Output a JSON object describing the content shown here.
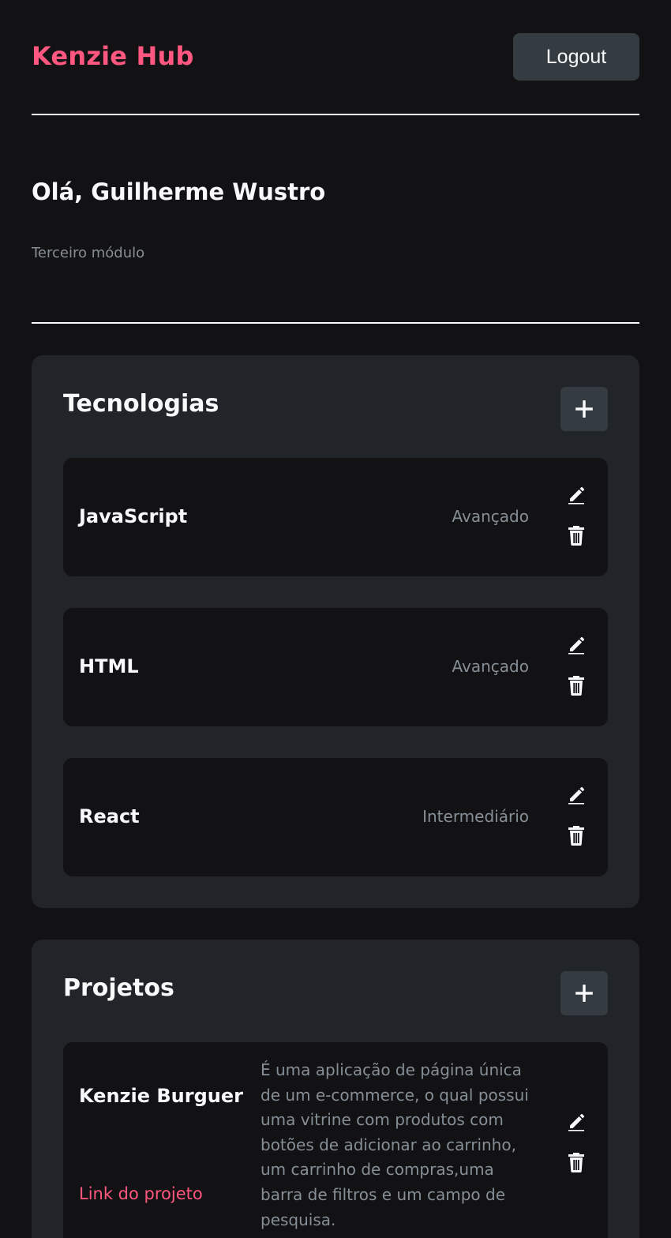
{
  "header": {
    "logo": "Kenzie Hub",
    "logout_label": "Logout"
  },
  "profile": {
    "greeting": "Olá, Guilherme Wustro",
    "module": "Terceiro módulo"
  },
  "technologies": {
    "title": "Tecnologias",
    "items": [
      {
        "name": "JavaScript",
        "level": "Avançado"
      },
      {
        "name": "HTML",
        "level": "Avançado"
      },
      {
        "name": "React",
        "level": "Intermediário"
      }
    ]
  },
  "projects": {
    "title": "Projetos",
    "items": [
      {
        "name": "Kenzie Burguer",
        "link_label": "Link do projeto",
        "description": "É uma aplicação de página única de um e-commerce, o qual possui uma vitrine com produtos com botões de adicionar ao carrinho, um carrinho de compras,uma barra de filtros e um campo de pesquisa."
      }
    ]
  },
  "colors": {
    "background": "#121214",
    "surface": "#212529",
    "button": "#343B41",
    "accent": "#FF577F",
    "muted_text": "#868E96",
    "text": "#F8F9FA"
  },
  "icons": [
    "plus-icon",
    "pencil-icon",
    "trash-icon"
  ]
}
